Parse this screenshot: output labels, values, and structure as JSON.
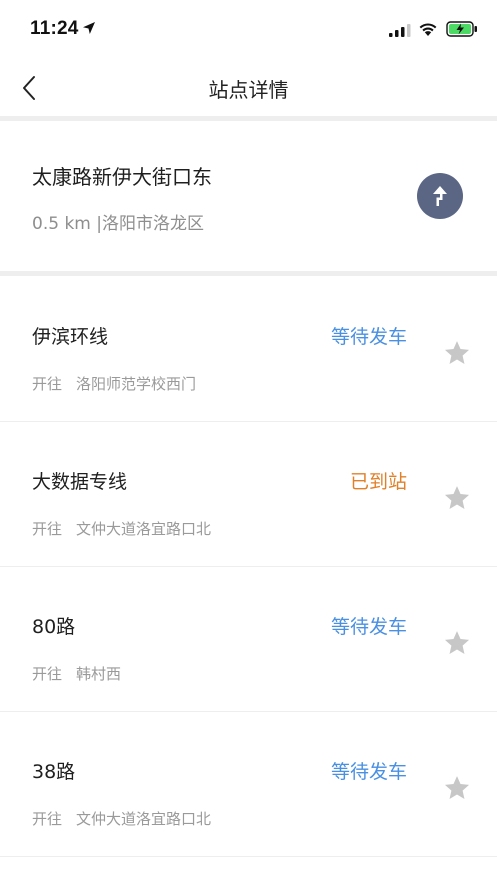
{
  "status_bar": {
    "time": "11:24"
  },
  "nav": {
    "title": "站点详情"
  },
  "station": {
    "name": "太康路新伊大街口东",
    "info": "0.5 km |洛阳市洛龙区"
  },
  "colors": {
    "waiting": "#4a90e2",
    "arrived": "#e0812a",
    "nav_circle": "#5b6685"
  },
  "routes": [
    {
      "name": "伊滨环线",
      "status": "等待发车",
      "status_type": "waiting",
      "dir_label": "开往",
      "destination": "洛阳师范学校西门"
    },
    {
      "name": "大数据专线",
      "status": "已到站",
      "status_type": "arrived",
      "dir_label": "开往",
      "destination": "文仲大道洛宜路口北"
    },
    {
      "name": "80路",
      "status": "等待发车",
      "status_type": "waiting",
      "dir_label": "开往",
      "destination": "韩村西"
    },
    {
      "name": "38路",
      "status": "等待发车",
      "status_type": "waiting",
      "dir_label": "开往",
      "destination": "文仲大道洛宜路口北"
    }
  ]
}
